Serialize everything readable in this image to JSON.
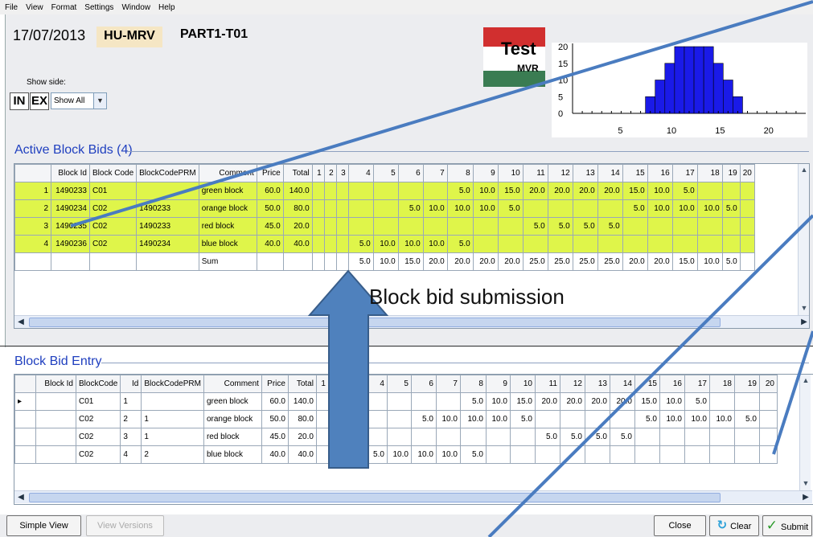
{
  "menu": [
    "File",
    "View",
    "Format",
    "Settings",
    "Window",
    "Help"
  ],
  "header": {
    "date": "17/07/2013",
    "member": "HU-MRV",
    "portfolio": "PART1-T01",
    "logo_text": "Test",
    "logo_sub": "MVR"
  },
  "show_side": {
    "label": "Show side:",
    "in_label": "IN",
    "ex_label": "EX",
    "selected": "Show All"
  },
  "colors": {
    "highlight": "#dff54a",
    "title_blue": "#1f3fbf",
    "bar_blue": "#1a1ae8",
    "annotation": "#4a7cc0"
  },
  "chart_data": {
    "type": "bar",
    "x": [
      8,
      9,
      10,
      11,
      12,
      13,
      14,
      15,
      16,
      17,
      18,
      19
    ],
    "values": [
      5,
      10,
      15,
      20,
      20,
      20,
      20,
      15,
      10,
      5,
      0,
      0
    ],
    "yticks": [
      "20",
      "15",
      "10",
      "5",
      "0"
    ],
    "xticks": [
      "5",
      "10",
      "15",
      "20"
    ],
    "xlim": [
      0,
      24
    ],
    "ylim": [
      0,
      20
    ]
  },
  "active": {
    "title": "Active Block Bids (4)",
    "headers": [
      "",
      "Block Id",
      "Block Code",
      "BlockCodePRM",
      "Comment",
      "Price",
      "Total",
      "1",
      "2",
      "3",
      "4",
      "5",
      "6",
      "7",
      "8",
      "9",
      "10",
      "11",
      "12",
      "13",
      "14",
      "15",
      "16",
      "17",
      "18",
      "19",
      "20"
    ],
    "rows": [
      [
        "1",
        "1490233",
        "C01",
        "",
        "green block",
        "60.0",
        "140.0",
        "",
        "",
        "",
        "",
        "",
        "",
        "",
        "5.0",
        "10.0",
        "15.0",
        "20.0",
        "20.0",
        "20.0",
        "20.0",
        "15.0",
        "10.0",
        "5.0",
        "",
        "",
        ""
      ],
      [
        "2",
        "1490234",
        "C02",
        "1490233",
        "orange block",
        "50.0",
        "80.0",
        "",
        "",
        "",
        "",
        "",
        "5.0",
        "10.0",
        "10.0",
        "10.0",
        "5.0",
        "",
        "",
        "",
        "",
        "5.0",
        "10.0",
        "10.0",
        "10.0",
        "5.0",
        ""
      ],
      [
        "3",
        "1490235",
        "C02",
        "1490233",
        "red block",
        "45.0",
        "20.0",
        "",
        "",
        "",
        "",
        "",
        "",
        "",
        "",
        "",
        "",
        "5.0",
        "5.0",
        "5.0",
        "5.0",
        "",
        "",
        "",
        "",
        "",
        ""
      ],
      [
        "4",
        "1490236",
        "C02",
        "1490234",
        "blue block",
        "40.0",
        "40.0",
        "",
        "",
        "",
        "5.0",
        "10.0",
        "10.0",
        "10.0",
        "5.0",
        "",
        "",
        "",
        "",
        "",
        "",
        "",
        "",
        "",
        "",
        "",
        ""
      ]
    ],
    "sum": [
      "",
      "",
      "",
      "",
      "Sum",
      "",
      "",
      "",
      "",
      "",
      "5.0",
      "10.0",
      "15.0",
      "20.0",
      "20.0",
      "20.0",
      "20.0",
      "25.0",
      "25.0",
      "25.0",
      "25.0",
      "20.0",
      "20.0",
      "15.0",
      "10.0",
      "5.0",
      ""
    ]
  },
  "entry": {
    "title": "Block Bid Entry",
    "headers": [
      "",
      "Block Id",
      "BlockCode",
      "Id",
      "BlockCodePRM",
      "Comment",
      "Price",
      "Total",
      "1",
      "2",
      "3",
      "4",
      "5",
      "6",
      "7",
      "8",
      "9",
      "10",
      "11",
      "12",
      "13",
      "14",
      "15",
      "16",
      "17",
      "18",
      "19",
      "20"
    ],
    "rows": [
      [
        "▸",
        "",
        "C01",
        "1",
        "",
        "green block",
        "60.0",
        "140.0",
        "",
        "",
        "",
        "",
        "",
        "",
        "",
        "5.0",
        "10.0",
        "15.0",
        "20.0",
        "20.0",
        "20.0",
        "20.0",
        "15.0",
        "10.0",
        "5.0",
        "",
        "",
        ""
      ],
      [
        "",
        "",
        "C02",
        "2",
        "1",
        "orange block",
        "50.0",
        "80.0",
        "",
        "",
        "",
        "",
        "",
        "5.0",
        "10.0",
        "10.0",
        "10.0",
        "5.0",
        "",
        "",
        "",
        "",
        "5.0",
        "10.0",
        "10.0",
        "10.0",
        "5.0",
        ""
      ],
      [
        "",
        "",
        "C02",
        "3",
        "1",
        "red block",
        "45.0",
        "20.0",
        "",
        "",
        "",
        "",
        "",
        "",
        "",
        "",
        "",
        "",
        "5.0",
        "5.0",
        "5.0",
        "5.0",
        "",
        "",
        "",
        "",
        "",
        ""
      ],
      [
        "",
        "",
        "C02",
        "4",
        "2",
        "blue block",
        "40.0",
        "40.0",
        "",
        "",
        "",
        "5.0",
        "10.0",
        "10.0",
        "10.0",
        "5.0",
        "",
        "",
        "",
        "",
        "",
        "",
        "",
        "",
        "",
        "",
        "",
        ""
      ]
    ]
  },
  "annotation": "Block bid submission",
  "buttons": {
    "simple_view": "Simple View",
    "view_versions": "View Versions",
    "close": "Close",
    "clear": "Clear",
    "submit": "Submit"
  }
}
